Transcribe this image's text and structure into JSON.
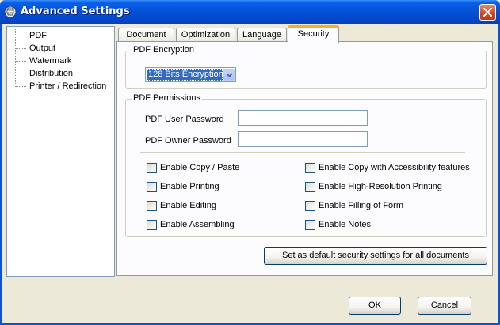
{
  "window": {
    "title": "Advanced Settings"
  },
  "tree": {
    "items": [
      {
        "label": "PDF"
      },
      {
        "label": "Output"
      },
      {
        "label": "Watermark"
      },
      {
        "label": "Distribution"
      },
      {
        "label": "Printer / Redirection"
      }
    ]
  },
  "tabs": [
    {
      "label": "Document"
    },
    {
      "label": "Optimization"
    },
    {
      "label": "Language"
    },
    {
      "label": "Security",
      "active": true
    }
  ],
  "security": {
    "encryption": {
      "group_title": "PDF Encryption",
      "selected": "128 Bits Encryption"
    },
    "permissions": {
      "group_title": "PDF Permissions",
      "user_password_label": "PDF User Password",
      "user_password_value": "",
      "owner_password_label": "PDF Owner Password",
      "owner_password_value": "",
      "checkboxes": [
        {
          "label": "Enable Copy / Paste",
          "checked": false
        },
        {
          "label": "Enable Copy with Accessibility features",
          "checked": false
        },
        {
          "label": "Enable Printing",
          "checked": false
        },
        {
          "label": "Enable High-Resolution Printing",
          "checked": false
        },
        {
          "label": "Enable Editing",
          "checked": false
        },
        {
          "label": "Enable Filling of Form",
          "checked": false
        },
        {
          "label": "Enable Assembling",
          "checked": false
        },
        {
          "label": "Enable Notes",
          "checked": false
        }
      ]
    },
    "default_button": "Set as default security settings for all documents"
  },
  "footer": {
    "ok_label": "OK",
    "cancel_label": "Cancel"
  },
  "colors": {
    "titlebar": "#0450d6",
    "selection": "#316ac5",
    "active_tab_accent": "#f2b032",
    "dialog_bg": "#ece9d8"
  }
}
